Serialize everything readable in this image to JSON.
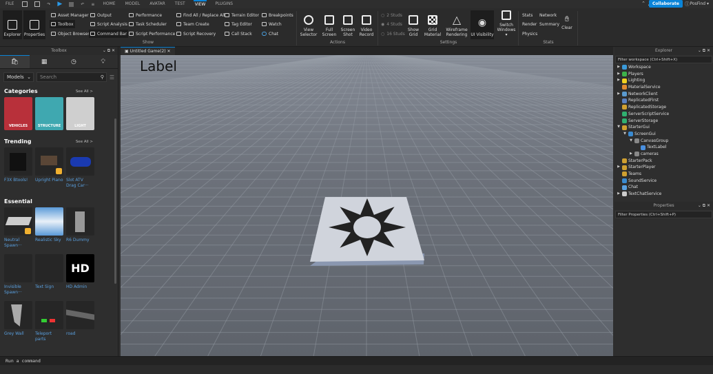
{
  "menubar": {
    "file": "FILE",
    "tabs": [
      "HOME",
      "MODEL",
      "AVATAR",
      "TEST",
      "VIEW",
      "PLUGINS"
    ],
    "active": "VIEW",
    "collaborate": "Collaborate",
    "user": "PosFind ▾"
  },
  "ribbon": {
    "explorer": "Explorer",
    "properties": "Properties",
    "col1": [
      "Asset Manager",
      "Toolbox",
      "Object Browser"
    ],
    "col2": [
      "Output",
      "Script Analysis",
      "Command Bar"
    ],
    "col3": [
      "Performance",
      "Task Scheduler",
      "Script Performance"
    ],
    "col4": [
      "Find All / Replace All",
      "Team Create",
      "Script Recovery"
    ],
    "col5": [
      "Terrain Editor",
      "Tag Editor",
      "Call Stack"
    ],
    "col6": [
      "Breakpoints",
      "Watch",
      "Chat"
    ],
    "show_group": "Show",
    "actions": [
      "View Selector",
      "Full Screen",
      "Screen Shot",
      "Video Record"
    ],
    "actions_group": "Actions",
    "studs": [
      "2 Studs",
      "4 Studs",
      "16 Studs"
    ],
    "settings": [
      "Show Grid",
      "Grid Material",
      "Wireframe Rendering",
      "UI Visibility",
      "Switch Windows ▾"
    ],
    "settings_group": "Settings",
    "stats": [
      "Stats",
      "Network",
      "Render",
      "Summary",
      "Physics"
    ],
    "clear": "Clear",
    "stats_group": "Stats"
  },
  "toolbox": {
    "title": "Toolbox",
    "dropdown": "Models",
    "search_placeholder": "Search",
    "categories_title": "Categories",
    "see_all": "See All >",
    "categories": [
      "VEHICLES",
      "STRUCTURE",
      "LIGHT"
    ],
    "trending_title": "Trending",
    "trending": [
      "F3X Btools!",
      "Upright Piano",
      "Slot ATV Drag Car···"
    ],
    "essential_title": "Essential",
    "essential": [
      "Neutral Spawn···",
      "Realistic Sky",
      "R6 Dummy",
      "Invisible Spawn···",
      "Text Sign",
      "HD Admin",
      "Grey Wall",
      "Teleport parts",
      "road"
    ],
    "hd_logo": "HD"
  },
  "document": {
    "tab": "Untitled Game(2)",
    "label": "Label"
  },
  "explorer": {
    "title": "Explorer",
    "filter": "Filter workspace (Ctrl+Shift+X)",
    "items": [
      {
        "name": "Workspace",
        "depth": 0,
        "arrow": "▶",
        "color": "#3a9ad9"
      },
      {
        "name": "Players",
        "depth": 0,
        "arrow": "▶",
        "color": "#3db24a"
      },
      {
        "name": "Lighting",
        "depth": 0,
        "arrow": "▶",
        "color": "#f0d020"
      },
      {
        "name": "MaterialService",
        "depth": 0,
        "arrow": "",
        "color": "#e08a30"
      },
      {
        "name": "NetworkClient",
        "depth": 0,
        "arrow": "▶",
        "color": "#5a9ad0"
      },
      {
        "name": "ReplicatedFirst",
        "depth": 0,
        "arrow": "",
        "color": "#5a80c0"
      },
      {
        "name": "ReplicatedStorage",
        "depth": 0,
        "arrow": "",
        "color": "#d0a030"
      },
      {
        "name": "ServerScriptService",
        "depth": 0,
        "arrow": "",
        "color": "#30b070"
      },
      {
        "name": "ServerStorage",
        "depth": 0,
        "arrow": "",
        "color": "#30b070"
      },
      {
        "name": "StarterGui",
        "depth": 0,
        "arrow": "▼",
        "color": "#d0a030"
      },
      {
        "name": "ScreenGui",
        "depth": 1,
        "arrow": "▼",
        "color": "#3a8ad0"
      },
      {
        "name": "CanvasGroup",
        "depth": 2,
        "arrow": "▼",
        "color": "#888888"
      },
      {
        "name": "TextLabel",
        "depth": 3,
        "arrow": "",
        "color": "#4a90e0"
      },
      {
        "name": "cameras",
        "depth": 2,
        "arrow": "▶",
        "color": "#888888"
      },
      {
        "name": "StarterPack",
        "depth": 0,
        "arrow": "",
        "color": "#d0a030"
      },
      {
        "name": "StarterPlayer",
        "depth": 0,
        "arrow": "▶",
        "color": "#d0a030"
      },
      {
        "name": "Teams",
        "depth": 0,
        "arrow": "",
        "color": "#d0a030"
      },
      {
        "name": "SoundService",
        "depth": 0,
        "arrow": "",
        "color": "#3a8ad0"
      },
      {
        "name": "Chat",
        "depth": 0,
        "arrow": "",
        "color": "#5aa0e0"
      },
      {
        "name": "TextChatService",
        "depth": 0,
        "arrow": "▶",
        "color": "#cccccc"
      }
    ]
  },
  "properties": {
    "title": "Properties",
    "filter": "Filter Properties (Ctrl+Shift+P)"
  },
  "command_bar": {
    "placeholder": "Run a command"
  }
}
